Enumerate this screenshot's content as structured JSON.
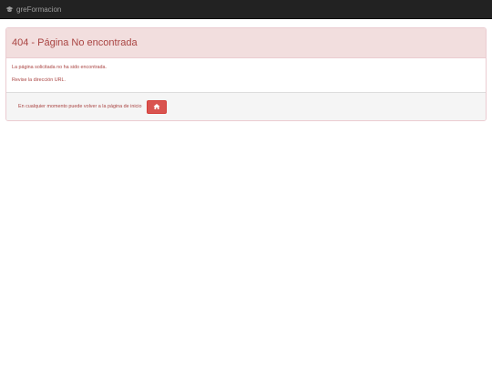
{
  "navbar": {
    "brand_text": "greFormacion",
    "brand_icon": "graduation-cap-icon"
  },
  "panel": {
    "title": "404 - Página No encontrada",
    "messages": [
      "La página solicitada no ha sido encontrada.",
      "Revise la dirección URL."
    ],
    "footer_text": "En cualquier momento puede volver a la página de inicio",
    "home_button_icon": "home-icon"
  },
  "colors": {
    "navbar_bg": "#222222",
    "danger_heading_bg": "#f2dede",
    "danger_text": "#a94442",
    "button_danger": "#d9534f"
  }
}
